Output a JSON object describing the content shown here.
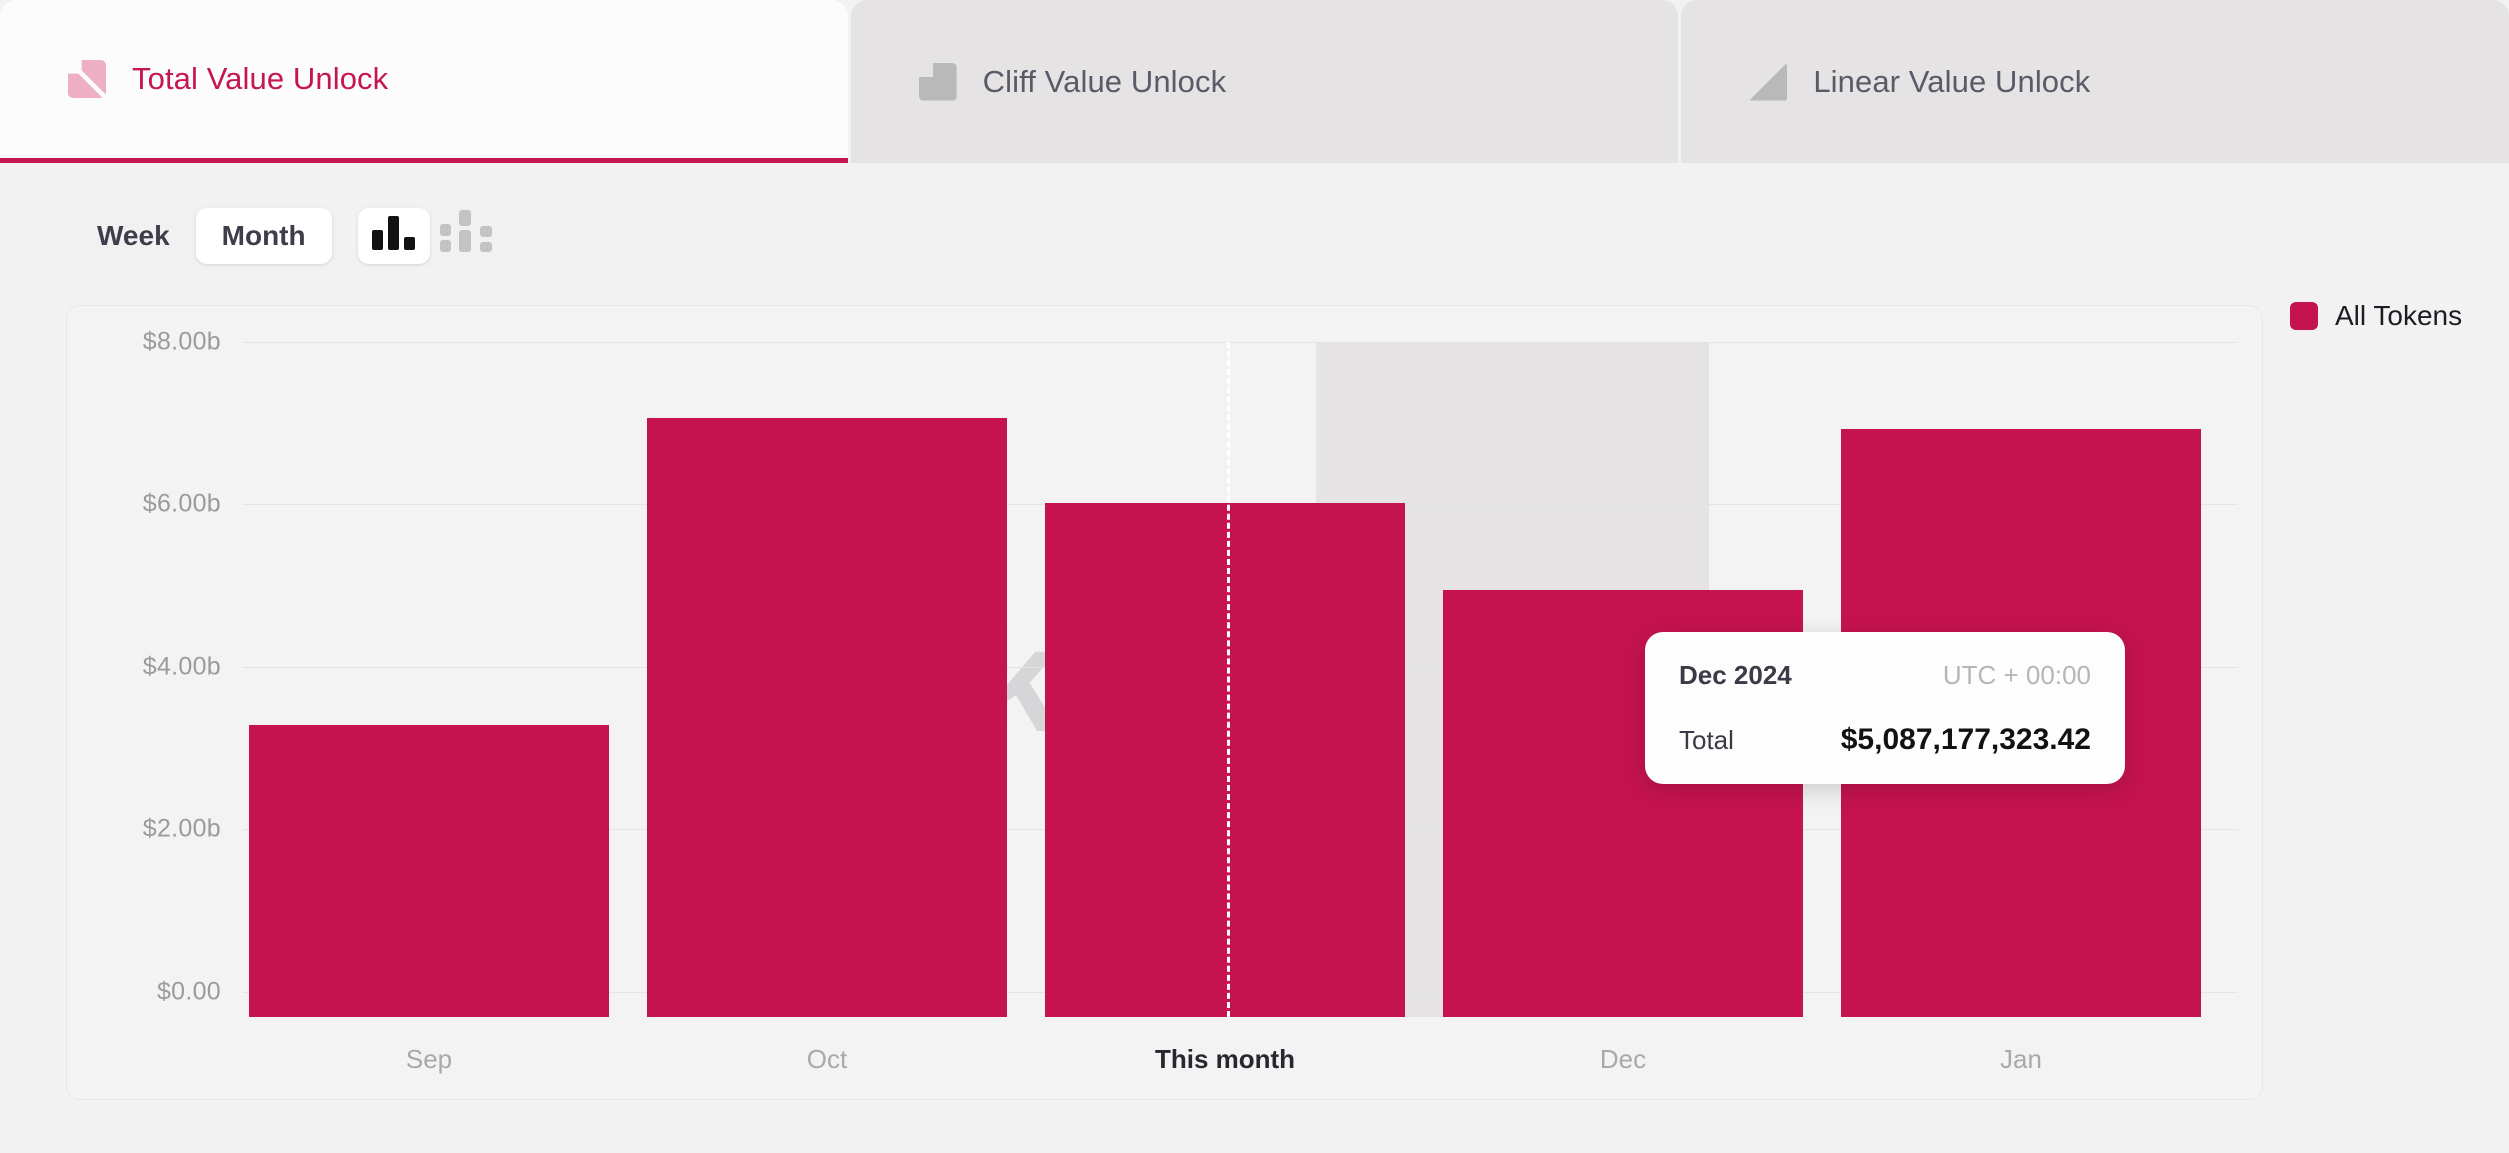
{
  "tabs": [
    {
      "id": "total",
      "label": "Total Value Unlock",
      "icon": "total-unlock-icon",
      "active": true
    },
    {
      "id": "cliff",
      "label": "Cliff Value Unlock",
      "icon": "cliff-unlock-icon",
      "active": false
    },
    {
      "id": "linear",
      "label": "Linear Value Unlock",
      "icon": "linear-unlock-icon",
      "active": false
    }
  ],
  "controls": {
    "interval": {
      "options": [
        "Week",
        "Month"
      ],
      "selected": "Month"
    },
    "chart_type": {
      "options": [
        "bar-chart-icon",
        "grouped-bar-chart-icon"
      ],
      "selected": "bar-chart-icon"
    }
  },
  "legend": [
    {
      "label": "All Tokens",
      "color": "#c5134f"
    }
  ],
  "tooltip": {
    "date": "Dec 2024",
    "timezone": "UTC + 00:00",
    "metric_label": "Total",
    "metric_value": "$5,087,177,323.42"
  },
  "watermark": "tokenomist",
  "colors": {
    "accent": "#c5134f",
    "accent_soft": "#eeaec4",
    "tab_inactive_bg": "#e5e3e4",
    "hover_band": "#e5e3e4",
    "grid": "#e4e4e5",
    "card_bg": "#f3f3f4",
    "page_bg": "#f2f2f2"
  },
  "chart_data": {
    "type": "bar",
    "title": "Total Value Unlock",
    "xlabel": "",
    "ylabel": "",
    "ylim": [
      0,
      8000000000
    ],
    "yticks": [
      0,
      2000000000,
      4000000000,
      6000000000,
      8000000000
    ],
    "ytick_labels": [
      "$0.00",
      "$2.00b",
      "$4.00b",
      "$6.00b",
      "$8.00b"
    ],
    "grid": true,
    "legend_position": "right",
    "categories": [
      "Sep",
      "Oct",
      "This month",
      "Dec",
      "Jan"
    ],
    "series": [
      {
        "name": "All Tokens",
        "color": "#c5134f",
        "values": [
          3600000000,
          7380000000,
          6330000000,
          5087177323.42,
          7240000000
        ],
        "value_labels": [
          "$3.60b",
          "$7.38b",
          "$6.33b",
          "$5,087,177,323.42",
          "$7.24b"
        ]
      }
    ],
    "highlighted_category": "Dec",
    "current_period_marker": {
      "category": "This month",
      "style": "dashed-vertical-line"
    }
  }
}
